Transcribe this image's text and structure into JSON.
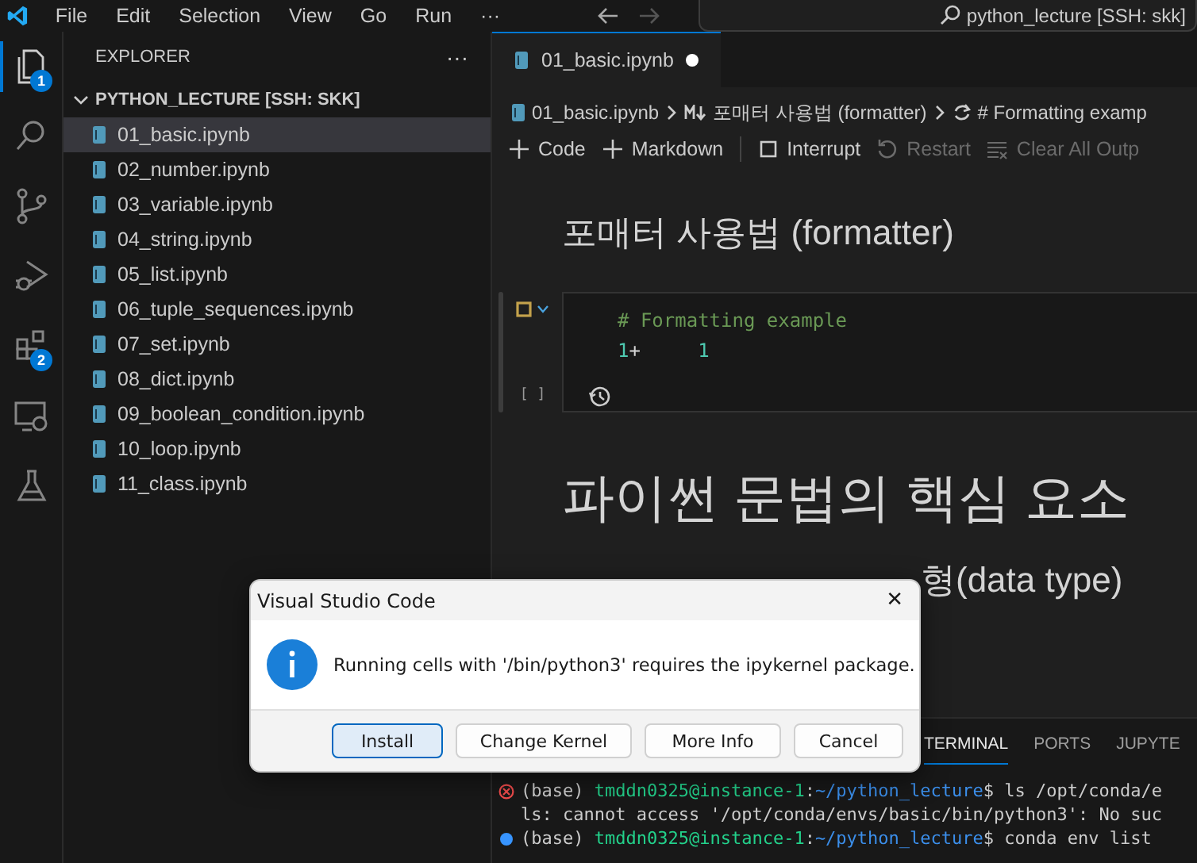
{
  "menu": [
    "File",
    "Edit",
    "Selection",
    "View",
    "Go",
    "Run",
    "···"
  ],
  "command_center": {
    "label": "python_lecture [SSH: skk]"
  },
  "activity_bar": [
    {
      "kind": "explorer",
      "selected": true,
      "badge": "1"
    },
    {
      "kind": "search",
      "selected": false
    },
    {
      "kind": "source-control",
      "selected": false
    },
    {
      "kind": "run-debug",
      "selected": false
    },
    {
      "kind": "extensions",
      "selected": false,
      "badge": "2"
    },
    {
      "kind": "remote",
      "selected": false
    },
    {
      "kind": "testing",
      "selected": false
    }
  ],
  "sidebar": {
    "title": "EXPLORER",
    "more": "···",
    "folder": {
      "label": "PYTHON_LECTURE [SSH: SKK]",
      "expanded": true
    },
    "items": [
      {
        "label": "01_basic.ipynb",
        "selected": true
      },
      {
        "label": "02_number.ipynb",
        "selected": false
      },
      {
        "label": "03_variable.ipynb",
        "selected": false
      },
      {
        "label": "04_string.ipynb",
        "selected": false
      },
      {
        "label": "05_list.ipynb",
        "selected": false
      },
      {
        "label": "06_tuple_sequences.ipynb",
        "selected": false
      },
      {
        "label": "07_set.ipynb",
        "selected": false
      },
      {
        "label": "08_dict.ipynb",
        "selected": false
      },
      {
        "label": "09_boolean_condition.ipynb",
        "selected": false
      },
      {
        "label": "10_loop.ipynb",
        "selected": false
      },
      {
        "label": "11_class.ipynb",
        "selected": false
      }
    ]
  },
  "tabs": [
    {
      "label": "01_basic.ipynb",
      "selected": true,
      "modified": true
    }
  ],
  "breadcrumb": [
    {
      "kind": "file",
      "label": "01_basic.ipynb"
    },
    {
      "kind": "markdown",
      "label": "포매터 사용법 (formatter)"
    },
    {
      "kind": "code",
      "label": "# Formatting examp"
    }
  ],
  "toolbar": [
    {
      "kind": "plus",
      "label": "Code",
      "disabled": false
    },
    {
      "kind": "plus",
      "label": "Markdown",
      "disabled": false
    },
    {
      "kind": "stop",
      "label": "Interrupt",
      "disabled": false
    },
    {
      "kind": "restart",
      "label": "Restart",
      "disabled": true
    },
    {
      "kind": "clear",
      "label": "Clear All Outp",
      "disabled": true
    }
  ],
  "cells": [
    {
      "kind": "heading2",
      "text": "포매터 사용법 (formatter)"
    },
    {
      "kind": "code",
      "exec_count": "[ ]",
      "lines": [
        [
          {
            "kind": "comment",
            "s": "# Formatting example"
          }
        ],
        [
          {
            "kind": "number",
            "s": "1"
          },
          {
            "kind": "op",
            "s": "+     "
          },
          {
            "kind": "number",
            "s": "1"
          }
        ]
      ]
    },
    {
      "kind": "heading1",
      "text": "파이썬 문법의 핵심 요소"
    },
    {
      "kind": "heading2",
      "text": "형(data type)"
    }
  ],
  "panel": {
    "tabs": [
      {
        "label": "TERMINAL",
        "selected": true
      },
      {
        "label": "PORTS",
        "selected": false
      },
      {
        "label": "JUPYTE",
        "selected": false
      }
    ],
    "lines": [
      {
        "kind": "error",
        "parts": [
          {
            "kind": "plain",
            "s": "(base) "
          },
          {
            "kind": "user",
            "s": "tmddn0325@instance-1"
          },
          {
            "kind": "plain",
            "s": ":"
          },
          {
            "kind": "path",
            "s": "~/python_lecture"
          },
          {
            "kind": "plain",
            "s": "$ ls /opt/conda/e"
          }
        ]
      },
      {
        "kind": "none",
        "parts": [
          {
            "kind": "plain",
            "s": "ls: cannot access '/opt/conda/envs/basic/bin/python3': No suc"
          }
        ]
      },
      {
        "kind": "info",
        "parts": [
          {
            "kind": "plain",
            "s": "(base) "
          },
          {
            "kind": "user",
            "s": "tmddn0325@instance-1"
          },
          {
            "kind": "plain",
            "s": ":"
          },
          {
            "kind": "path",
            "s": "~/python_lecture"
          },
          {
            "kind": "plain",
            "s": "$ conda env list"
          }
        ]
      }
    ]
  },
  "dialog": {
    "title": "Visual Studio Code",
    "close": "✕",
    "message": "Running cells with '/bin/python3' requires the ipykernel package.",
    "buttons": [
      {
        "label": "Install",
        "focused": true
      },
      {
        "label": "Change Kernel",
        "focused": false
      },
      {
        "label": "More Info",
        "focused": false
      },
      {
        "label": "Cancel",
        "focused": false
      }
    ]
  }
}
